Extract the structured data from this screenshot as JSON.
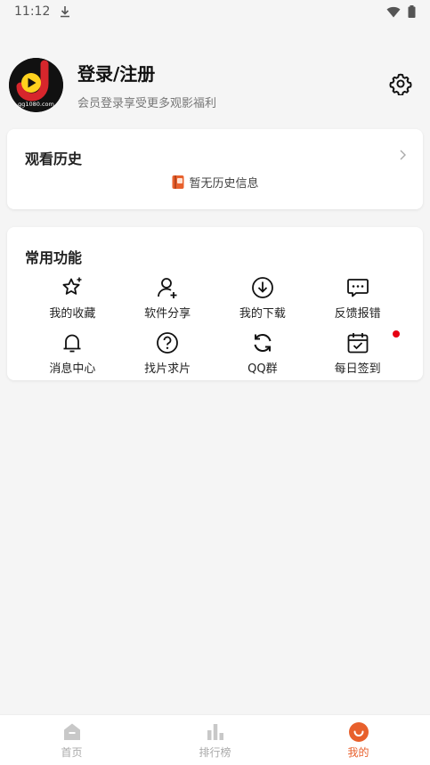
{
  "status_bar": {
    "time": "11:12"
  },
  "profile": {
    "title": "登录/注册",
    "subtitle": "会员登录享受更多观影福利",
    "avatar_caption": "gg1080.com"
  },
  "history": {
    "title": "观看历史",
    "empty_text": "暂无历史信息"
  },
  "functions": {
    "title": "常用功能",
    "items": [
      {
        "label": "我的收藏",
        "icon": "star-icon"
      },
      {
        "label": "软件分享",
        "icon": "user-add-icon"
      },
      {
        "label": "我的下载",
        "icon": "download-icon"
      },
      {
        "label": "反馈报错",
        "icon": "message-icon"
      },
      {
        "label": "消息中心",
        "icon": "bell-icon"
      },
      {
        "label": "找片求片",
        "icon": "question-icon"
      },
      {
        "label": "QQ群",
        "icon": "refresh-icon"
      },
      {
        "label": "每日签到",
        "icon": "calendar-check-icon"
      }
    ]
  },
  "tabbar": {
    "tabs": [
      {
        "label": "首页",
        "icon": "home-icon",
        "active": false
      },
      {
        "label": "排行榜",
        "icon": "bar-chart-icon",
        "active": false
      },
      {
        "label": "我的",
        "icon": "smile-icon",
        "active": true
      }
    ]
  },
  "colors": {
    "accent": "#e8602c",
    "badge": "#e60012",
    "inactive": "#aaaaaa"
  }
}
